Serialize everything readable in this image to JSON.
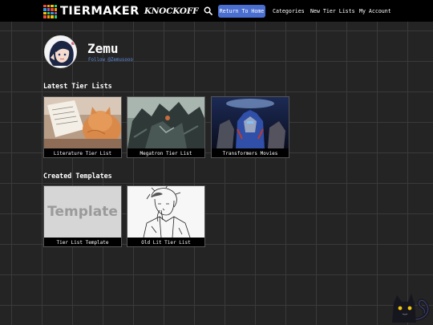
{
  "header": {
    "logo_text": "TIERMAKER",
    "logo_sub": "KNOCKOFF",
    "return_button": "Return To Home",
    "nav": [
      "Categories",
      "New Tier Lists",
      "My Account"
    ],
    "logo_colors": [
      "#e84c3d",
      "#f39c12",
      "#f1c40f",
      "#2ecc71",
      "#3498db",
      "#9b59b6",
      "#e84c3d",
      "#f39c12",
      "#f1c40f",
      "#2ecc71",
      "#3498db",
      "#9b59b6",
      "#e84c3d",
      "#f39c12",
      "#f1c40f",
      "#2ecc71"
    ]
  },
  "profile": {
    "name": "Zemu",
    "follow": "Follow @Zemusooo"
  },
  "sections": {
    "latest_title": "Latest Tier Lists",
    "created_title": "Created Templates"
  },
  "latest": [
    {
      "label": "Literature Tier List"
    },
    {
      "label": "Megatron Tier List"
    },
    {
      "label": "Transformers Movies"
    }
  ],
  "created": [
    {
      "label": "Tier List Template",
      "thumb_text": "Template"
    },
    {
      "label": "Old Lit Tier List"
    }
  ],
  "colors": {
    "accent": "#4b6fd1",
    "link": "#5c8de0",
    "background": "#242424"
  }
}
